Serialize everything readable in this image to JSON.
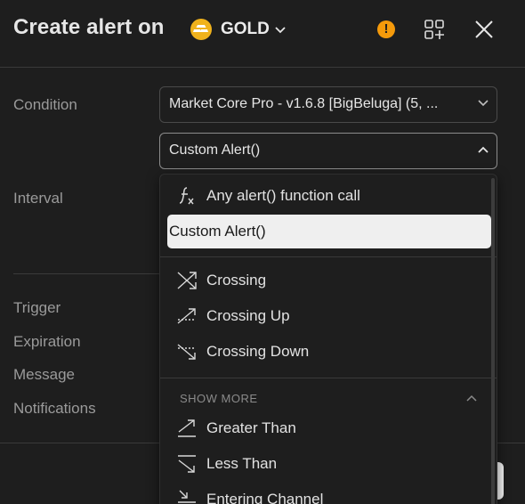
{
  "header": {
    "title": "Create alert on",
    "symbol": "GOLD",
    "warning_glyph": "!"
  },
  "form": {
    "condition_label": "Condition",
    "indicator_value": "Market Core Pro - v1.6.8 [BigBeluga] (5, ...",
    "alert_value": "Custom Alert()",
    "interval_label": "Interval",
    "trigger_label": "Trigger",
    "expiration_label": "Expiration",
    "message_label": "Message",
    "notifications_label": "Notifications"
  },
  "dropdown": {
    "items_top": [
      {
        "label": "Any alert() function call",
        "icon": "function-icon"
      },
      {
        "label": "Custom Alert()",
        "icon": "",
        "selected": true
      }
    ],
    "items_crossing": [
      {
        "label": "Crossing",
        "icon": "crossing-icon"
      },
      {
        "label": "Crossing Up",
        "icon": "crossing-up-icon"
      },
      {
        "label": "Crossing Down",
        "icon": "crossing-down-icon"
      }
    ],
    "show_more_label": "SHOW MORE",
    "items_more": [
      {
        "label": "Greater Than",
        "icon": "greater-than-icon"
      },
      {
        "label": "Less Than",
        "icon": "less-than-icon"
      },
      {
        "label": "Entering Channel",
        "icon": "entering-channel-icon"
      }
    ]
  },
  "colors": {
    "background": "#1e1e1e",
    "accent_gold": "#f0b21c",
    "warning": "#f59a0b",
    "selected_bg": "#efefef"
  }
}
